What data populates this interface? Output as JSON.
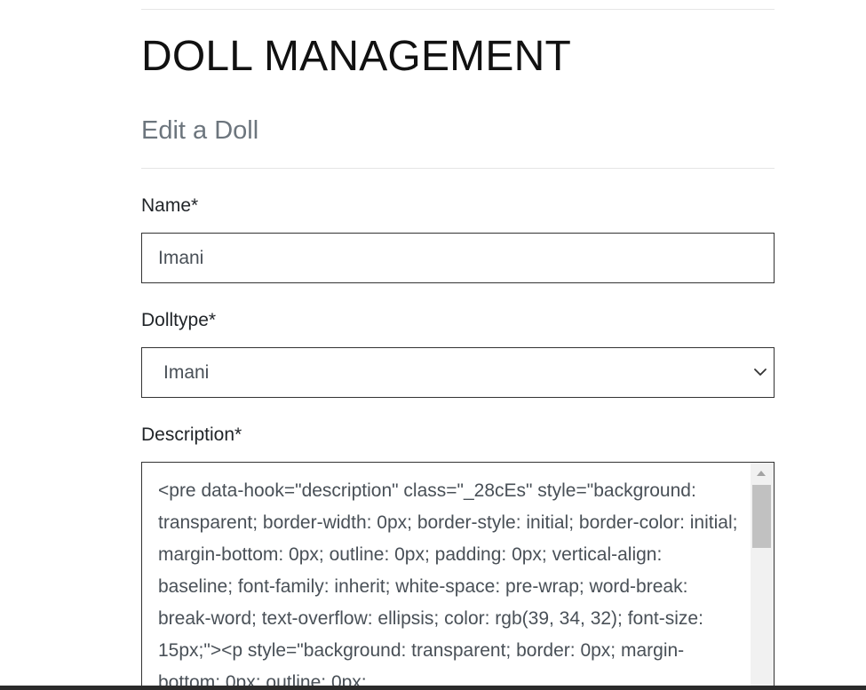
{
  "header": {
    "title": "DOLL MANAGEMENT",
    "subtitle": "Edit a Doll"
  },
  "form": {
    "name": {
      "label": "Name*",
      "value": "Imani"
    },
    "dolltype": {
      "label": "Dolltype*",
      "selected": "Imani"
    },
    "description": {
      "label": "Description*",
      "value": "<pre data-hook=\"description\" class=\"_28cEs\" style=\"background: transparent; border-width: 0px; border-style: initial; border-color: initial; margin-bottom: 0px; outline: 0px; padding: 0px; vertical-align: baseline; font-family: inherit; white-space: pre-wrap; word-break: break-word; text-overflow: ellipsis; color: rgb(39, 34, 32); font-size: 15px;\"><p style=\"background: transparent; border: 0px; margin-bottom: 0px; outline: 0px;"
    }
  },
  "icons": {
    "select_chevron": "chevron-down-icon",
    "scroll_up": "arrow-up-icon"
  },
  "colors": {
    "subtitle": "#6c757d",
    "border": "#333333",
    "rule": "#e5e5e5",
    "input_text": "#495057"
  }
}
